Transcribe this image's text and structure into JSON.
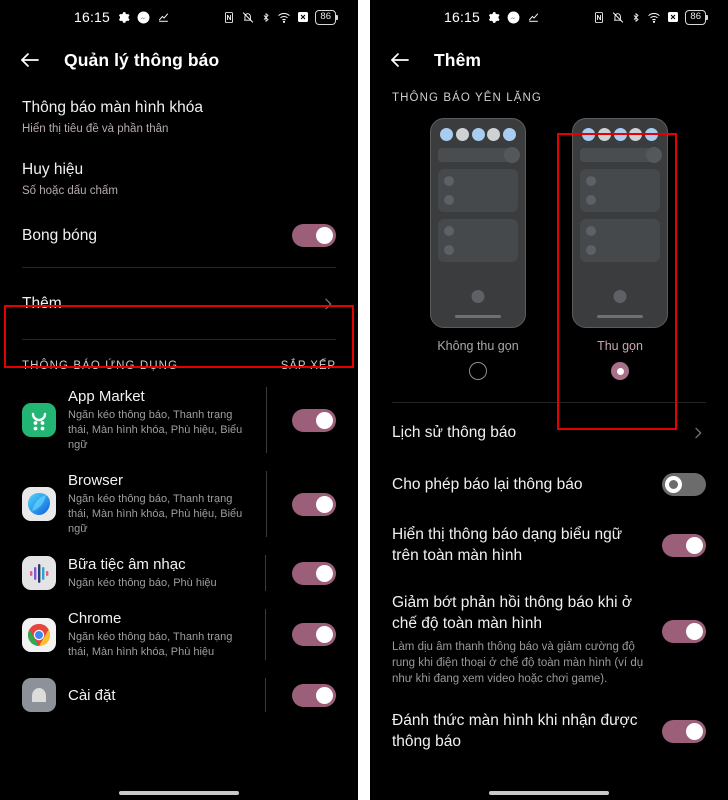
{
  "status_bar": {
    "time": "16:15",
    "left_icons": [
      "gear-icon",
      "messenger-icon",
      "check-activity-icon"
    ],
    "right_icons": [
      "nfc-icon",
      "silent-bell-icon",
      "bluetooth-icon",
      "wifi-icon",
      "no-signal-icon"
    ],
    "battery_level": "86"
  },
  "left_panel": {
    "app_bar": {
      "back": "back-arrow",
      "title": "Quản lý thông báo"
    },
    "settings": [
      {
        "title": "Thông báo màn hình khóa",
        "sub": "Hiển thị tiêu đề và phần thân",
        "control": "none"
      },
      {
        "title": "Huy hiệu",
        "sub": "Số hoặc dấu chấm",
        "control": "none"
      },
      {
        "title": "Bong bóng",
        "sub": "",
        "control": "toggle",
        "toggle_state": "on"
      }
    ],
    "more_row": {
      "title": "Thêm",
      "control": "chevron",
      "highlighted": true
    },
    "apps_section": {
      "label": "THÔNG BÁO ỨNG DỤNG",
      "action": "SẮP XẾP",
      "items": [
        {
          "name": "App Market",
          "desc": "Ngăn kéo thông báo, Thanh trạng thái, Màn hình khóa, Phù hiệu, Biểu ngữ",
          "icon": "app-market-icon",
          "toggle_state": "on"
        },
        {
          "name": "Browser",
          "desc": "Ngăn kéo thông báo, Thanh trạng thái, Màn hình khóa, Phù hiệu, Biểu ngữ",
          "icon": "browser-icon",
          "toggle_state": "on"
        },
        {
          "name": "Bữa tiệc âm nhạc",
          "desc": "Ngăn kéo thông báo, Phù hiệu",
          "icon": "music-party-icon",
          "toggle_state": "on"
        },
        {
          "name": "Chrome",
          "desc": "Ngăn kéo thông báo, Thanh trạng thái, Màn hình khóa, Phù hiệu",
          "icon": "chrome-icon",
          "toggle_state": "on"
        },
        {
          "name": "Cài đặt",
          "desc": "",
          "icon": "settings-icon",
          "toggle_state": "on"
        }
      ]
    }
  },
  "right_panel": {
    "app_bar": {
      "back": "back-arrow",
      "title": "Thêm"
    },
    "silent_section": {
      "label": "THÔNG BÁO YÊN LẶNG",
      "options": [
        {
          "label": "Không thu gọn",
          "selected": false
        },
        {
          "label": "Thu gọn",
          "selected": true,
          "highlighted": true
        }
      ]
    },
    "settings": [
      {
        "title": "Lịch sử thông báo",
        "sub": "",
        "control": "chevron"
      },
      {
        "title": "Cho phép báo lại thông báo",
        "sub": "",
        "control": "toggle",
        "toggle_state": "off"
      },
      {
        "title": "Hiển thị thông báo dạng biểu ngữ trên toàn màn hình",
        "sub": "",
        "control": "toggle",
        "toggle_state": "on"
      },
      {
        "title": "Giảm bớt phản hồi thông báo khi ở chế độ toàn màn hình",
        "sub": "Làm dịu âm thanh thông báo và giảm cường độ rung khi điện thoại ở chế độ toàn màn hình (ví dụ như khi đang xem video hoặc chơi game).",
        "control": "toggle",
        "toggle_state": "on"
      },
      {
        "title": "Đánh thức màn hình khi nhận được thông báo",
        "sub": "",
        "control": "toggle",
        "toggle_state": "on"
      }
    ]
  },
  "colors": {
    "background": "#000000",
    "toggle_on": "#9c5f7a",
    "toggle_off": "#6c6c6c",
    "highlight_box": "#e60000",
    "accent_radio": "#a8708a"
  }
}
